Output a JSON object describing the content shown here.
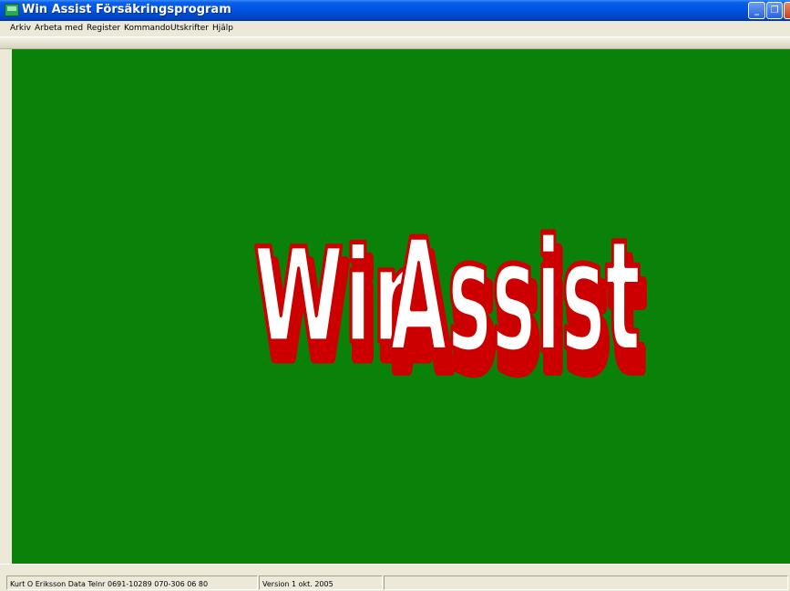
{
  "window": {
    "title": "Win Assist Försäkringsprogram",
    "buttons": {
      "minimize": "_",
      "maximize": "❐",
      "close": "✕"
    }
  },
  "menu": {
    "items": [
      "Arkiv",
      "Arbeta med",
      "Register",
      "Kommando",
      "Utskrifter",
      "Hjälp"
    ]
  },
  "logo": {
    "word1": "Win",
    "word2": "Assist",
    "colors": {
      "background": "#0a820a",
      "fill": "#ffffff",
      "outline": "#cc0000"
    }
  },
  "status": {
    "company": "Kurt O Eriksson Data Telnr 0691-10289  070-306 06 80",
    "version": "Version 1 okt. 2005",
    "empty": ""
  }
}
